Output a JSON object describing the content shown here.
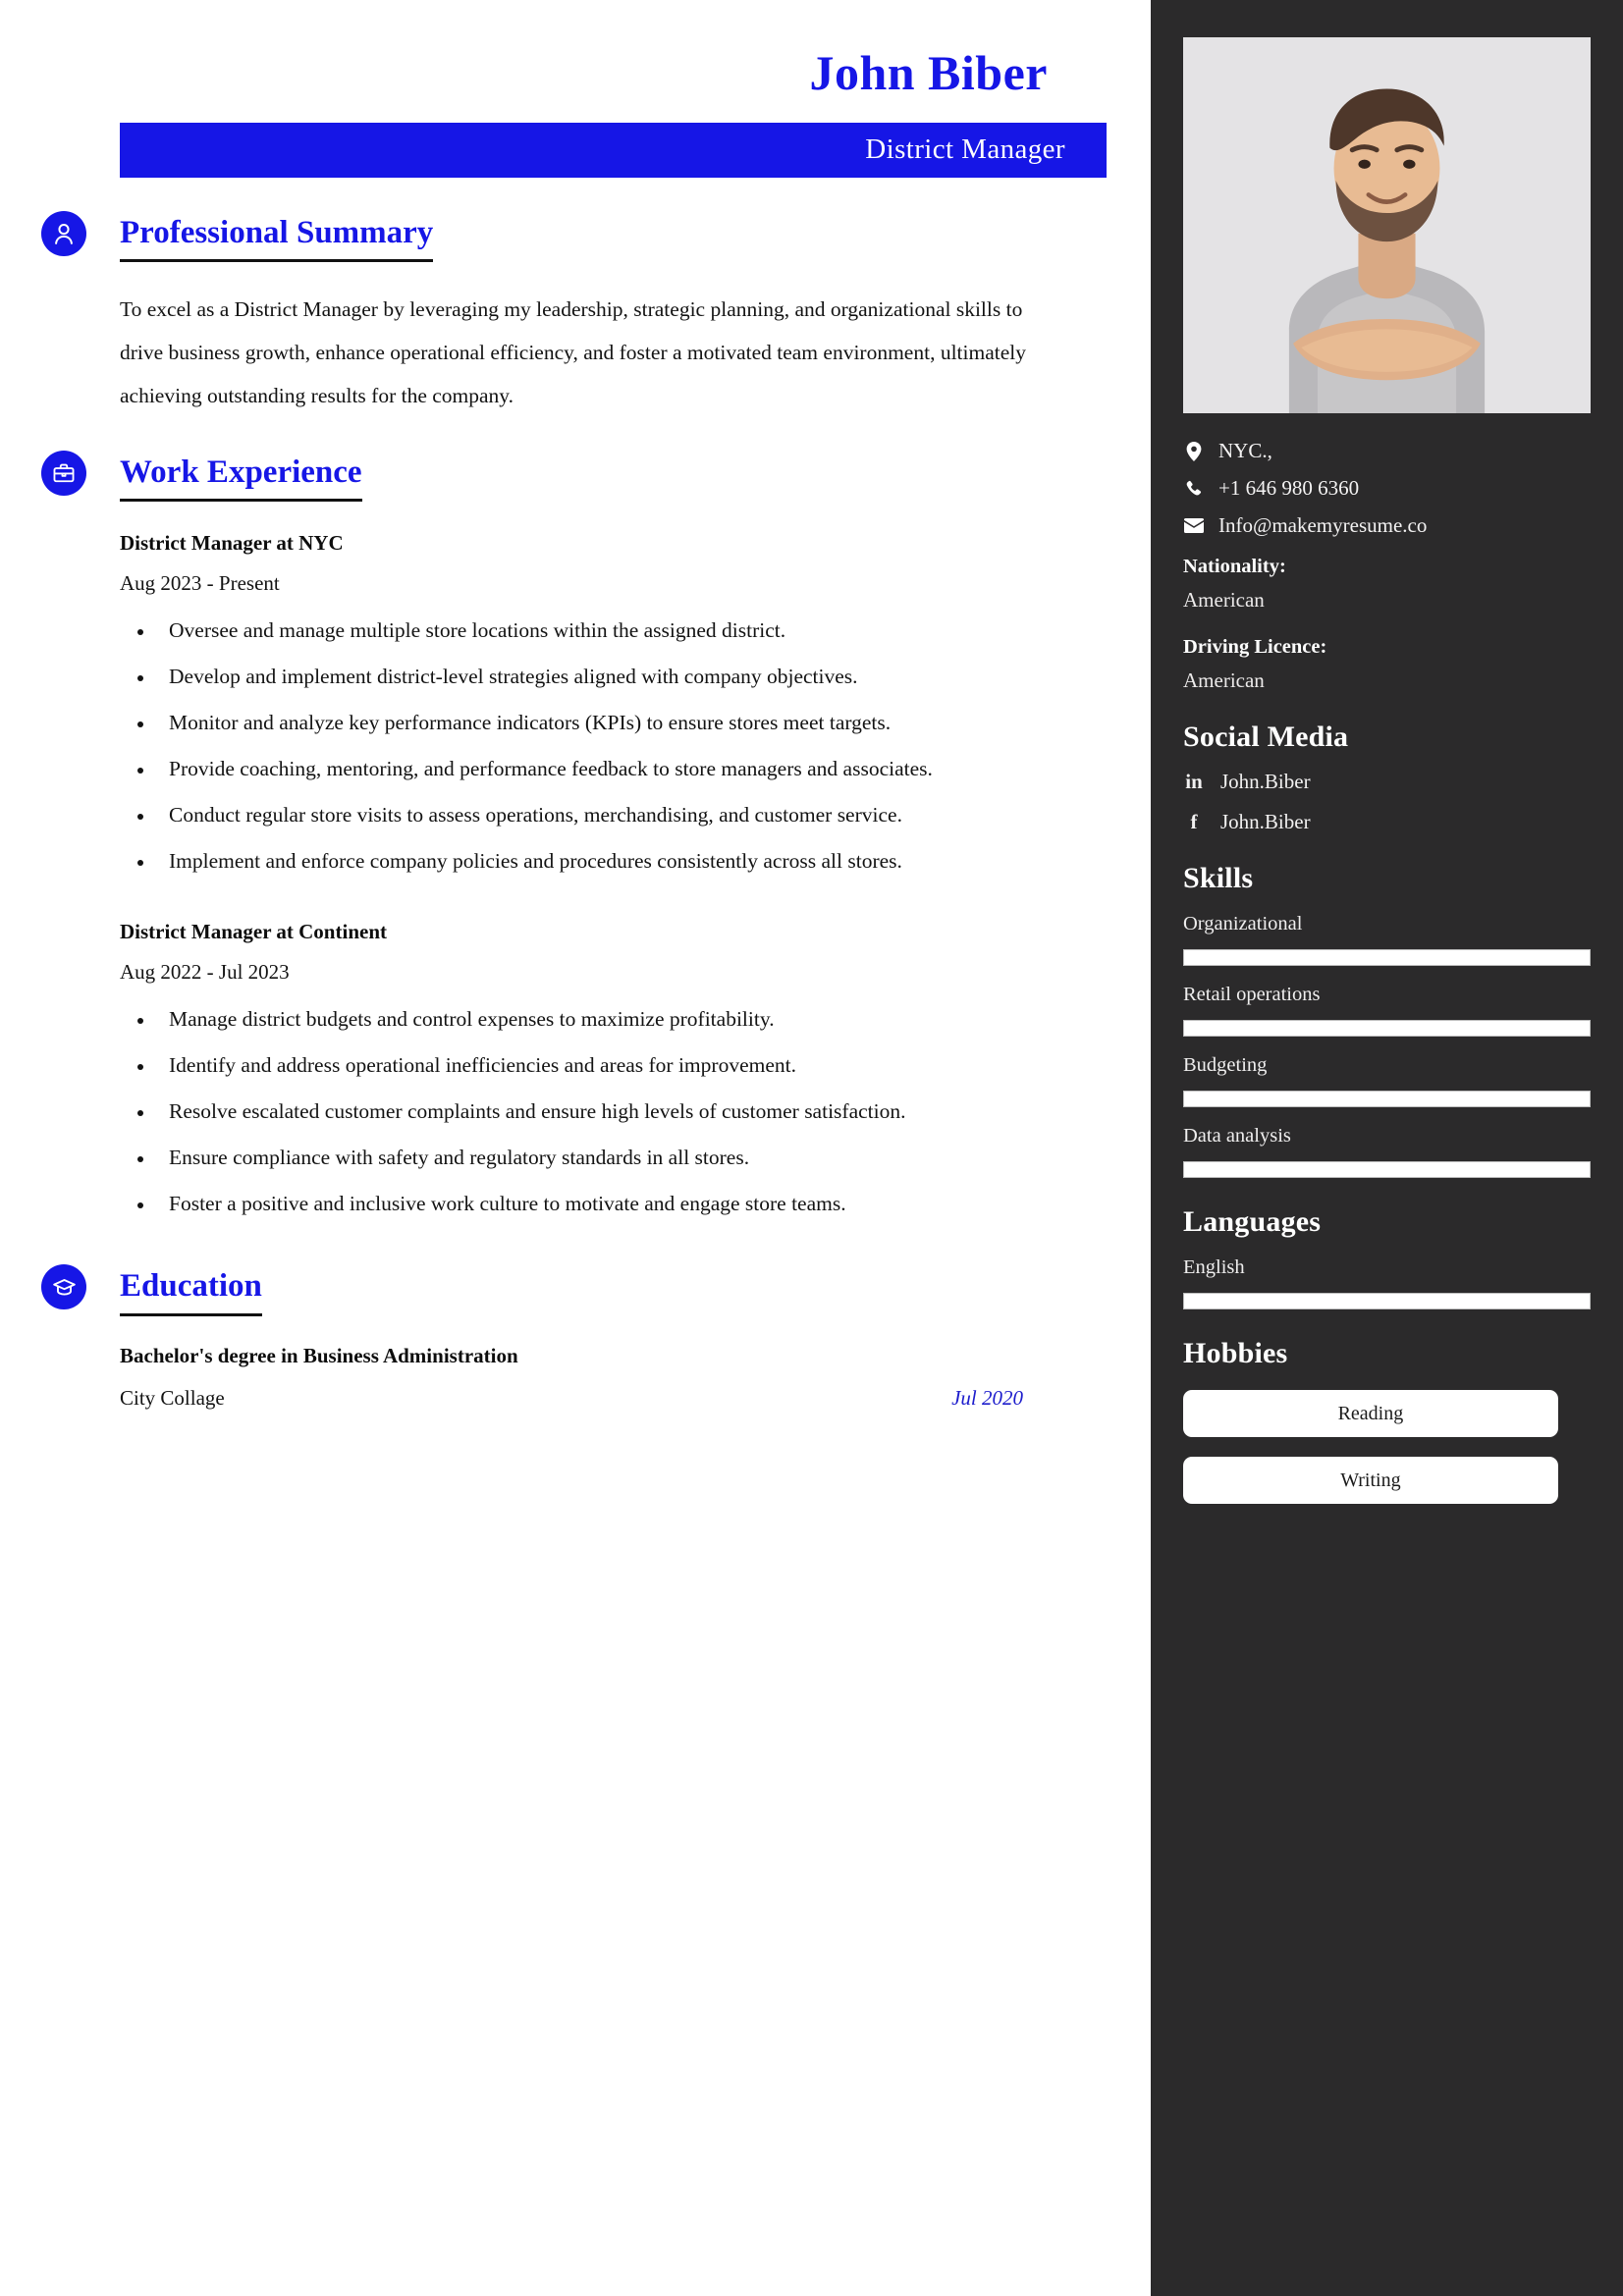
{
  "header": {
    "name": "John Biber",
    "job_title": "District Manager",
    "accent_color": "#1616e6",
    "sidebar_color": "#2b2a2b"
  },
  "sections": {
    "summary": {
      "title": "Professional Summary",
      "icon": "person-icon",
      "text": "To excel as a District Manager by leveraging my leadership, strategic planning, and organizational skills to drive business growth, enhance operational efficiency, and foster a motivated team environment, ultimately achieving outstanding results for the company."
    },
    "work": {
      "title": "Work Experience",
      "icon": "briefcase-icon",
      "jobs": [
        {
          "role": "District Manager at NYC",
          "date": "Aug 2023 - Present",
          "bullets": [
            "Oversee and manage multiple store locations within the assigned district.",
            "Develop and implement district-level strategies aligned with company objectives.",
            "Monitor and analyze key performance indicators (KPIs) to ensure stores meet targets.",
            "Provide coaching, mentoring, and performance feedback to store managers and associates.",
            "Conduct regular store visits to assess operations, merchandising, and customer service.",
            "Implement and enforce company policies and procedures consistently across all stores."
          ]
        },
        {
          "role": "District Manager at Continent",
          "date": "Aug 2022 - Jul 2023",
          "bullets": [
            "Manage district budgets and control expenses to maximize profitability.",
            "Identify and address operational inefficiencies and areas for improvement.",
            "Resolve escalated customer complaints and ensure high levels of customer satisfaction.",
            "Ensure compliance with safety and regulatory standards in all stores.",
            "Foster a positive and inclusive work culture to motivate and engage store teams."
          ]
        }
      ]
    },
    "education": {
      "title": "Education",
      "icon": "graduation-cap-icon",
      "entries": [
        {
          "degree": "Bachelor's degree in Business Administration",
          "school": "City Collage",
          "date": "Jul 2020"
        }
      ]
    }
  },
  "sidebar": {
    "photo_alt": "portrait-photo",
    "contact": [
      {
        "icon": "location-pin-icon",
        "value": "NYC.,"
      },
      {
        "icon": "phone-icon",
        "value": "+1 646 980 6360"
      },
      {
        "icon": "envelope-icon",
        "value": "Info@makemyresume.co"
      }
    ],
    "details": [
      {
        "label": "Nationality:",
        "value": "American"
      },
      {
        "label": "Driving Licence:",
        "value": "American"
      }
    ],
    "social": {
      "heading": "Social Media",
      "items": [
        {
          "icon": "linkedin-icon",
          "glyph": "in",
          "value": "John.Biber"
        },
        {
          "icon": "facebook-icon",
          "glyph": "f",
          "value": "John.Biber"
        }
      ]
    },
    "skills": {
      "heading": "Skills",
      "items": [
        {
          "name": "Organizational",
          "level": 100
        },
        {
          "name": "Retail operations",
          "level": 100
        },
        {
          "name": "Budgeting",
          "level": 100
        },
        {
          "name": "Data analysis",
          "level": 100
        }
      ]
    },
    "languages": {
      "heading": "Languages",
      "items": [
        {
          "name": "English",
          "level": 100
        }
      ]
    },
    "hobbies": {
      "heading": "Hobbies",
      "items": [
        {
          "label": "Reading"
        },
        {
          "label": "Writing"
        }
      ]
    }
  }
}
